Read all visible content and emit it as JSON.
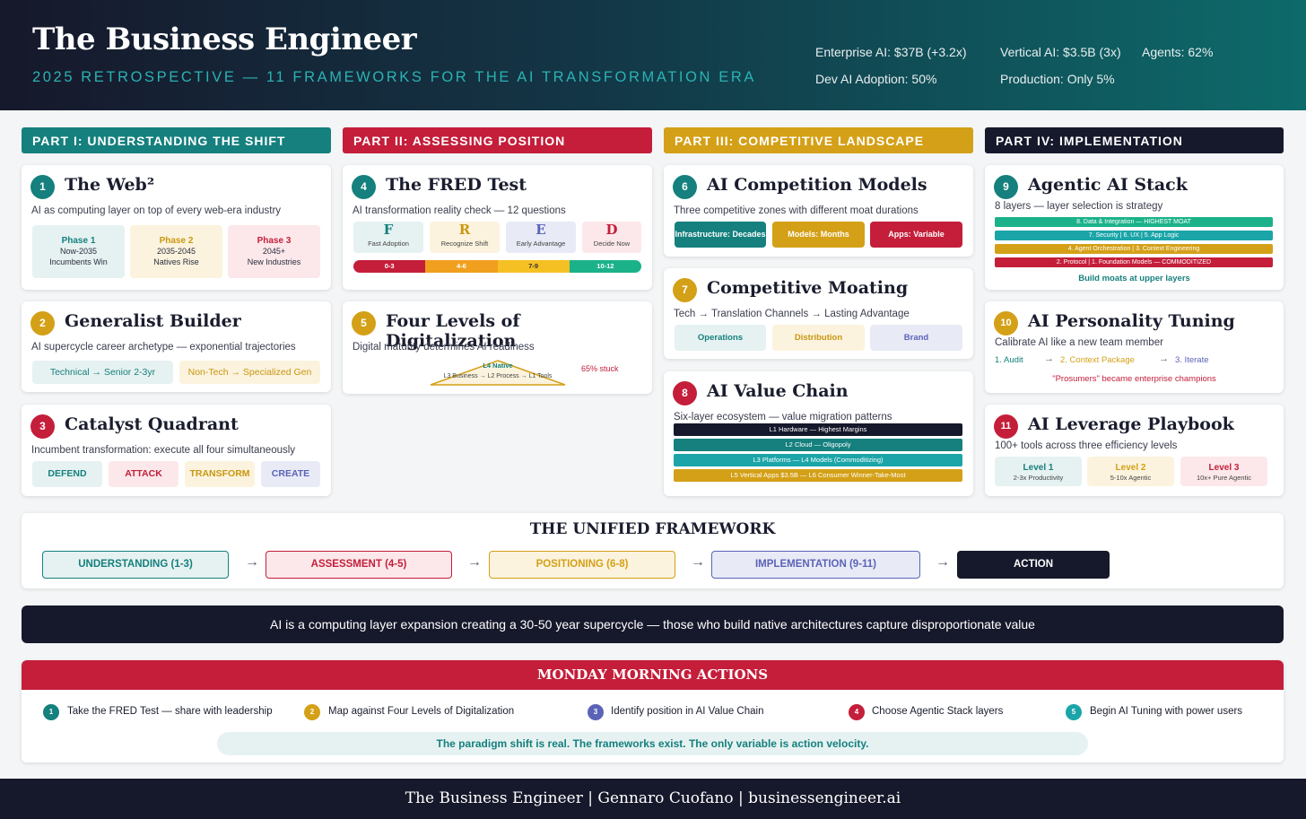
{
  "header": {
    "title": "The Business Engineer",
    "subtitle": "2025 RETROSPECTIVE — 11 FRAMEWORKS FOR THE AI TRANSFORMATION ERA",
    "stats": {
      "enterprise": "Enterprise AI: $37B (+3.2x)",
      "vertical": "Vertical AI: $3.5B (3x)",
      "agents": "Agents: 62%",
      "dev": "Dev AI Adoption: 50%",
      "production": "Production: Only 5%"
    }
  },
  "parts": [
    {
      "label": "PART I: UNDERSTANDING THE SHIFT",
      "color": "#15807e"
    },
    {
      "label": "PART II: ASSESSING POSITION",
      "color": "#c41e3a"
    },
    {
      "label": "PART III: COMPETITIVE LANDSCAPE",
      "color": "#d4a017"
    },
    {
      "label": "PART IV: IMPLEMENTATION",
      "color": "#16182b"
    }
  ],
  "c1": {
    "num": "1",
    "title": "The Web²",
    "desc": "AI as computing layer on top of every web-era industry",
    "phases": [
      {
        "name": "Phase 1",
        "years": "Now-2035",
        "note": "Incumbents Win"
      },
      {
        "name": "Phase 2",
        "years": "2035-2045",
        "note": "Natives Rise"
      },
      {
        "name": "Phase 3",
        "years": "2045+",
        "note": "New Industries"
      }
    ]
  },
  "c2": {
    "num": "2",
    "title": "Generalist Builder",
    "desc": "AI supercycle career archetype — exponential trajectories",
    "tech": "Technical → Senior 2-3yr",
    "nontech": "Non-Tech → Specialized Gen"
  },
  "c3": {
    "num": "3",
    "title": "Catalyst Quadrant",
    "desc": "Incumbent transformation: execute all four simultaneously",
    "actions": [
      "DEFEND",
      "ATTACK",
      "TRANSFORM",
      "CREATE"
    ]
  },
  "c4": {
    "num": "4",
    "title": "The FRED Test",
    "desc": "AI transformation reality check — 12 questions",
    "letters": [
      {
        "l": "F",
        "t": "Fast Adoption"
      },
      {
        "l": "R",
        "t": "Recognize Shift"
      },
      {
        "l": "E",
        "t": "Early Advantage"
      },
      {
        "l": "D",
        "t": "Decide Now"
      }
    ],
    "scale": [
      "0-3",
      "4-6",
      "7-9",
      "10-12"
    ]
  },
  "c5": {
    "num": "5",
    "title": "Four Levels of Digitalization",
    "desc": "Digital maturity determines AI readiness",
    "top": "L4 Native",
    "bottom": "L3 Business → L2 Process → L1 Tools",
    "stuck": "65% stuck"
  },
  "c6": {
    "num": "6",
    "title": "AI Competition Models",
    "desc": "Three competitive zones with different moat durations",
    "zones": [
      "Infrastructure: Decades",
      "Models: Months",
      "Apps: Variable"
    ]
  },
  "c7": {
    "num": "7",
    "title": "Competitive Moating",
    "desc": "Tech → Translation Channels → Lasting Advantage",
    "items": [
      "Operations",
      "Distribution",
      "Brand"
    ]
  },
  "c8": {
    "num": "8",
    "title": "AI Value Chain",
    "desc": "Six-layer ecosystem — value migration patterns",
    "layers": [
      "L1 Hardware — Highest Margins",
      "L2 Cloud — Oligopoly",
      "L3 Platforms — L4 Models (Commoditizing)",
      "L5 Vertical Apps $3.5B — L6 Consumer Winner-Take-Most"
    ]
  },
  "c9": {
    "num": "9",
    "title": "Agentic AI Stack",
    "desc": "8 layers — layer selection is strategy",
    "layers": [
      "8. Data & Integration — HIGHEST MOAT",
      "7. Security | 6. UX | 5. App Logic",
      "4. Agent Orchestration | 3. Context Engineering",
      "2. Protocol | 1. Foundation Models — COMMODITIZED"
    ],
    "note": "Build moats at upper layers"
  },
  "c10": {
    "num": "10",
    "title": "AI Personality Tuning",
    "desc": "Calibrate AI like a new team member",
    "steps": [
      "1. Audit",
      "2. Context Package",
      "3. Iterate"
    ],
    "note": "\"Prosumers\" became enterprise champions"
  },
  "c11": {
    "num": "11",
    "title": "AI Leverage Playbook",
    "desc": "100+ tools across three efficiency levels",
    "levels": [
      {
        "name": "Level 1",
        "note": "2-3x Productivity"
      },
      {
        "name": "Level 2",
        "note": "5-10x Agentic"
      },
      {
        "name": "Level 3",
        "note": "10x+ Pure Agentic"
      }
    ]
  },
  "unified": {
    "title": "THE UNIFIED FRAMEWORK",
    "steps": [
      "UNDERSTANDING (1-3)",
      "ASSESSMENT (4-5)",
      "POSITIONING (6-8)",
      "IMPLEMENTATION (9-11)",
      "ACTION"
    ]
  },
  "banner": "AI is a computing layer expansion creating a 30-50 year supercycle — those who build native architectures capture disproportionate value",
  "monday": {
    "title": "MONDAY MORNING ACTIONS",
    "actions": [
      {
        "n": "1",
        "t": "Take the FRED Test — share with leadership"
      },
      {
        "n": "2",
        "t": "Map against Four Levels of Digitalization"
      },
      {
        "n": "3",
        "t": "Identify position in AI Value Chain"
      },
      {
        "n": "4",
        "t": "Choose Agentic Stack layers"
      },
      {
        "n": "5",
        "t": "Begin AI Tuning with power users"
      }
    ],
    "closing": "The paradigm shift is real. The frameworks exist. The only variable is action velocity."
  },
  "footer": "The Business Engineer | Gennaro Cuofano | businessengineer.ai",
  "colors": {
    "teal": "#15807e",
    "red": "#c41e3a",
    "gold": "#d4a017",
    "navy": "#16182b",
    "indigo": "#5b63b7",
    "cyan": "#1ba5a8"
  }
}
